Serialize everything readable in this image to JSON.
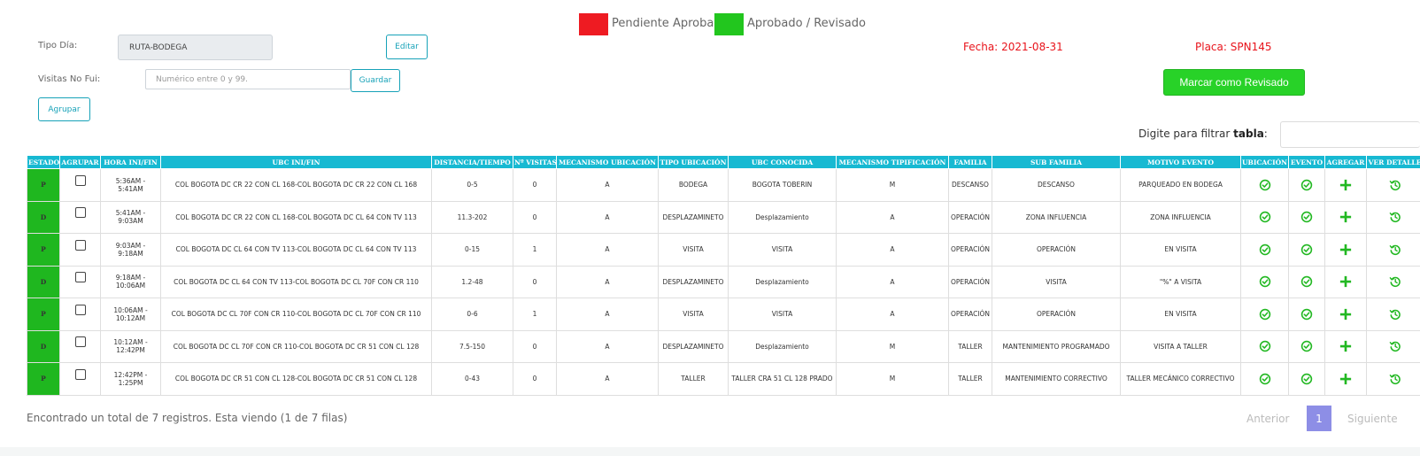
{
  "legend": {
    "pending_label": "Pendiente Aprobar",
    "approved_label": "Aprobado / Revisado",
    "pending_color": "#ee1b22",
    "approved_color": "#22c61e"
  },
  "form": {
    "tipo_dia_label": "Tipo Día:",
    "tipo_dia_value": "RUTA-BODEGA",
    "editar_label": "Editar",
    "visitas_label": "Visitas No Fui:",
    "visitas_placeholder": "Numérico entre 0 y 99.",
    "guardar_label": "Guardar",
    "agrupar_label": "Agrupar"
  },
  "info": {
    "fecha_label": "Fecha:",
    "fecha_value": "2021-08-31",
    "placa_label": "Placa:",
    "placa_value": "SPN145"
  },
  "marcar_button": "Marcar como Revisado",
  "filter": {
    "label": "Digite para filtrar",
    "label_bold": "tabla",
    "suffix": ":"
  },
  "table": {
    "headers": [
      "ESTADO",
      "AGRUPAR",
      "HORA INI/FIN",
      "UBC INI/FIN",
      "DISTANCIA/TIEMPO",
      "Nº VISITAS",
      "MECANISMO UBICACIÓN",
      "TIPO UBICACIÓN",
      "UBC CONOCIDA",
      "MECANISMO TIPIFICACIÓN",
      "FAMILIA",
      "SUB FAMILIA",
      "MOTIVO EVENTO",
      "UBICACIÓN",
      "EVENTO",
      "AGREGAR",
      "VER DETALLE"
    ],
    "rows": [
      {
        "estado": "P",
        "hora": "5:36AM - 5:41AM",
        "ubc": "COL BOGOTA DC CR 22 CON CL 168-COL BOGOTA DC CR 22 CON CL 168",
        "dist": "0-5",
        "visitas": "0",
        "mec_ubic": "A",
        "tipo_ubic": "BODEGA",
        "ubc_conocida": "BOGOTA TOBERIN",
        "mec_tip": "M",
        "familia": "DESCANSO",
        "sub_familia": "DESCANSO",
        "motivo": "PARQUEADO EN BODEGA"
      },
      {
        "estado": "D",
        "hora": "5:41AM - 9:03AM",
        "ubc": "COL BOGOTA DC CR 22 CON CL 168-COL BOGOTA DC CL 64 CON TV 113",
        "dist": "11.3-202",
        "visitas": "0",
        "mec_ubic": "A",
        "tipo_ubic": "DESPLAZAMINETO",
        "ubc_conocida": "Desplazamiento",
        "mec_tip": "A",
        "familia": "OPERACIÓN",
        "sub_familia": "ZONA INFLUENCIA",
        "motivo": "ZONA INFLUENCIA"
      },
      {
        "estado": "P",
        "hora": "9:03AM - 9:18AM",
        "ubc": "COL BOGOTA DC CL 64 CON TV 113-COL BOGOTA DC CL 64 CON TV 113",
        "dist": "0-15",
        "visitas": "1",
        "mec_ubic": "A",
        "tipo_ubic": "VISITA",
        "ubc_conocida": "VISITA",
        "mec_tip": "A",
        "familia": "OPERACIÓN",
        "sub_familia": "OPERACIÓN",
        "motivo": "EN VISITA"
      },
      {
        "estado": "D",
        "hora": "9:18AM - 10:06AM",
        "ubc": "COL BOGOTA DC CL 64 CON TV 113-COL BOGOTA DC CL 70F CON CR 110",
        "dist": "1.2-48",
        "visitas": "0",
        "mec_ubic": "A",
        "tipo_ubic": "DESPLAZAMINETO",
        "ubc_conocida": "Desplazamiento",
        "mec_tip": "A",
        "familia": "OPERACIÓN",
        "sub_familia": "VISITA",
        "motivo": "\"%\" A VISITA"
      },
      {
        "estado": "P",
        "hora": "10:06AM - 10:12AM",
        "ubc": "COL BOGOTA DC CL 70F CON CR 110-COL BOGOTA DC CL 70F CON CR 110",
        "dist": "0-6",
        "visitas": "1",
        "mec_ubic": "A",
        "tipo_ubic": "VISITA",
        "ubc_conocida": "VISITA",
        "mec_tip": "A",
        "familia": "OPERACIÓN",
        "sub_familia": "OPERACIÓN",
        "motivo": "EN VISITA"
      },
      {
        "estado": "D",
        "hora": "10:12AM - 12:42PM",
        "ubc": "COL BOGOTA DC CL 70F CON CR 110-COL BOGOTA DC CR 51 CON CL 128",
        "dist": "7.5-150",
        "visitas": "0",
        "mec_ubic": "A",
        "tipo_ubic": "DESPLAZAMINETO",
        "ubc_conocida": "Desplazamiento",
        "mec_tip": "M",
        "familia": "TALLER",
        "sub_familia": "MANTENIMIENTO PROGRAMADO",
        "motivo": "VISITA A TALLER"
      },
      {
        "estado": "P",
        "hora": "12:42PM - 1:25PM",
        "ubc": "COL BOGOTA DC CR 51 CON CL 128-COL BOGOTA DC CR 51 CON CL 128",
        "dist": "0-43",
        "visitas": "0",
        "mec_ubic": "A",
        "tipo_ubic": "TALLER",
        "ubc_conocida": "TALLER CRA 51 CL 128 PRADO",
        "mec_tip": "M",
        "familia": "TALLER",
        "sub_familia": "MANTENIMIENTO CORRECTIVO",
        "motivo": "TALLER MECÁNICO CORRECTIVO"
      }
    ]
  },
  "footer": {
    "summary": "Encontrado un total de 7 registros. Esta viendo (1 de 7 filas)",
    "prev_label": "Anterior",
    "page": "1",
    "next_label": "Siguiente"
  },
  "colors": {
    "header_bg": "#17b9d2",
    "estado_bg": "#1fb71f",
    "icon_green": "#22b822",
    "accent_red": "#e8131b",
    "button_outline": "#17a2b8"
  },
  "icons": {
    "ubicacion": "check-circle-icon",
    "evento": "check-circle-icon",
    "agregar": "plus-icon",
    "ver_detalle": "history-icon"
  }
}
